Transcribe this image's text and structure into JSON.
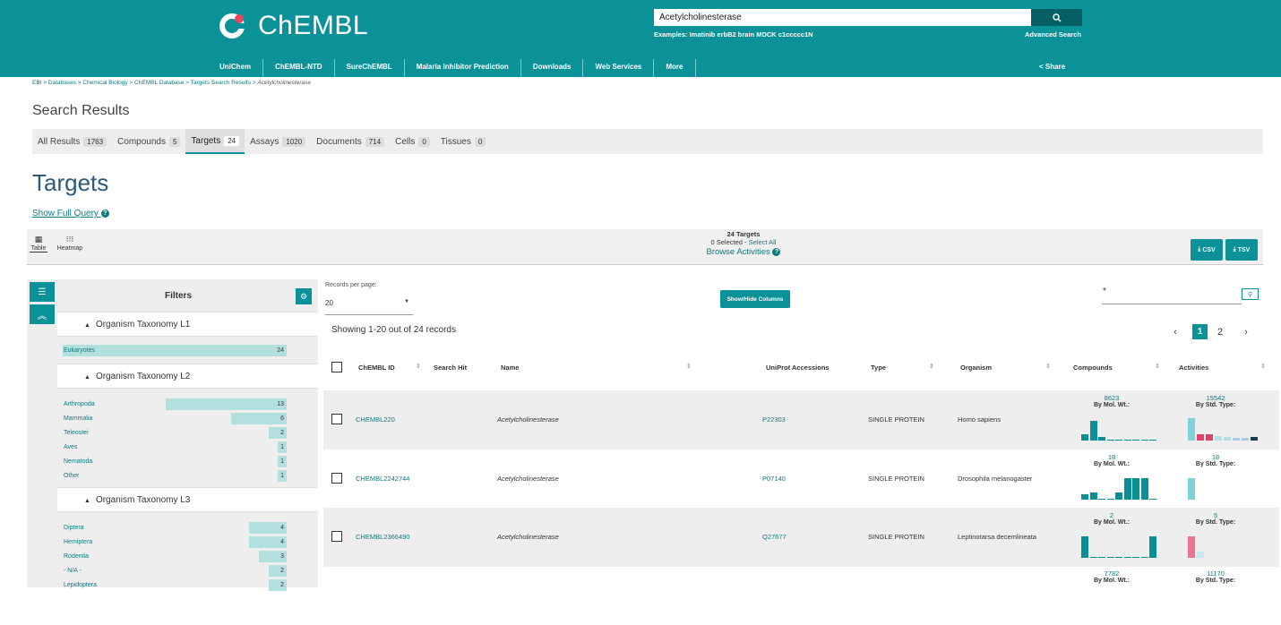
{
  "header": {
    "logo_text": "ChEMBL",
    "search_value": "Acetylcholinesterase",
    "examples": "Examples: Imatinib erbB2 brain MDCK c1ccccc1N",
    "advanced_search": "Advanced Search",
    "share": "Share",
    "nav": [
      "UniChem",
      "ChEMBL-NTD",
      "SureChEMBL",
      "Malaria Inhibitor Prediction",
      "Downloads",
      "Web Services",
      "More"
    ],
    "brand_color": "#0b9298"
  },
  "breadcrumb": {
    "items": [
      "EBI",
      "Databases",
      "Chemical Biology",
      "ChEMBL Database",
      "Targets Search Results"
    ],
    "current": "Acetylcholinesterase"
  },
  "search_results": {
    "title": "Search Results",
    "tabs": [
      {
        "label": "All Results",
        "count": "1763"
      },
      {
        "label": "Compounds",
        "count": "5"
      },
      {
        "label": "Targets",
        "count": "24"
      },
      {
        "label": "Assays",
        "count": "1020"
      },
      {
        "label": "Documents",
        "count": "714"
      },
      {
        "label": "Cells",
        "count": "0"
      },
      {
        "label": "Tissues",
        "count": "0"
      }
    ],
    "active_tab": "Targets"
  },
  "section": {
    "title": "Targets",
    "show_full_query": "Show Full Query"
  },
  "toolbar": {
    "view_table": "Table",
    "view_heatmap": "Heatmap",
    "count_label": "24 Targets",
    "selected_text": "0 Selected -",
    "select_all": "Select All",
    "browse_activities": "Browse Activities",
    "csv": "CSV",
    "tsv": "TSV"
  },
  "filters": {
    "title": "Filters",
    "groups": [
      {
        "name": "Organism Taxonomy L1",
        "items": [
          {
            "label": "Eukaryotes",
            "count": "24",
            "frac": 1.0
          }
        ]
      },
      {
        "name": "Organism Taxonomy L2",
        "items": [
          {
            "label": "Arthropoda",
            "count": "13",
            "frac": 0.54
          },
          {
            "label": "Mammalia",
            "count": "6",
            "frac": 0.25
          },
          {
            "label": "Teleostei",
            "count": "2",
            "frac": 0.08
          },
          {
            "label": "Aves",
            "count": "1",
            "frac": 0.04
          },
          {
            "label": "Nematoda",
            "count": "1",
            "frac": 0.04
          },
          {
            "label": "Other",
            "count": "1",
            "frac": 0.04
          }
        ]
      },
      {
        "name": "Organism Taxonomy L3",
        "items": [
          {
            "label": "Diptera",
            "count": "4",
            "frac": 0.17
          },
          {
            "label": "Hemiptera",
            "count": "4",
            "frac": 0.17
          },
          {
            "label": "Rodentia",
            "count": "3",
            "frac": 0.125
          },
          {
            "label": "- N/A -",
            "count": "2",
            "frac": 0.08
          },
          {
            "label": "Lepidoptera",
            "count": "2",
            "frac": 0.08
          }
        ]
      }
    ]
  },
  "table_controls": {
    "records_per_page_label": "Records per page:",
    "records_per_page": "20",
    "show_hide_columns": "Show/Hide Columns",
    "search_value": "*",
    "showing": "Showing 1-20 out of 24 records",
    "pages": [
      "1",
      "2"
    ],
    "current_page": "1"
  },
  "table": {
    "columns": [
      "ChEMBL ID",
      "Search Hit",
      "Name",
      "UniProt Accessions",
      "Type",
      "Organism",
      "Compounds",
      "Activities"
    ],
    "by_mol_wt": "By Mol. Wt.:",
    "by_std_type": "By Std. Type:",
    "rows": [
      {
        "chembl_id": "CHEMBL220",
        "name": "Acetylcholinesterase",
        "uniprot": "P22303",
        "type": "SINGLE PROTEIN",
        "organism": "Homo sapiens",
        "compounds": "8623",
        "activities": "15542",
        "mw_hist": [
          0.25,
          0.8,
          0.15,
          0.05,
          0.05,
          0.05,
          0.05,
          0.05,
          0.05
        ],
        "act_hist": [
          {
            "h": 0.9,
            "c": "#7fd3d8"
          },
          {
            "h": 0.25,
            "c": "#d9456b"
          },
          {
            "h": 0.25,
            "c": "#d9456b"
          },
          {
            "h": 0.18,
            "c": "#b8dde8"
          },
          {
            "h": 0.15,
            "c": "#b8dde8"
          },
          {
            "h": 0.12,
            "c": "#a9c9e8"
          },
          {
            "h": 0.12,
            "c": "#a9c9e8"
          },
          {
            "h": 0.15,
            "c": "#1c3b4a"
          }
        ]
      },
      {
        "chembl_id": "CHEMBL2242744",
        "name": "Acetylcholinesterase",
        "uniprot": "P07140",
        "type": "SINGLE PROTEIN",
        "organism": "Drosophila melanogaster",
        "compounds": "18",
        "activities": "18",
        "mw_hist": [
          0.2,
          0.3,
          0.05,
          0.05,
          0.3,
          0.85,
          0.85,
          0.85,
          0.05
        ],
        "act_hist": [
          {
            "h": 0.85,
            "c": "#7fd3d8"
          }
        ]
      },
      {
        "chembl_id": "CHEMBL2366490",
        "name": "Acetylcholinesterase",
        "uniprot": "Q27677",
        "type": "SINGLE PROTEIN",
        "organism": "Leptinotarsa decemlineata",
        "compounds": "2",
        "activities": "5",
        "mw_hist": [
          0.85,
          0.05,
          0.05,
          0.05,
          0.05,
          0.05,
          0.05,
          0.05,
          0.85
        ],
        "act_hist": [
          {
            "h": 0.85,
            "c": "#e87591"
          },
          {
            "h": 0.25,
            "c": "#c9e9ec"
          }
        ]
      },
      {
        "chembl_id": "",
        "name": "",
        "uniprot": "",
        "type": "",
        "organism": "",
        "compounds": "7782",
        "activities": "11170",
        "mw_hist": [],
        "act_hist": []
      }
    ]
  }
}
